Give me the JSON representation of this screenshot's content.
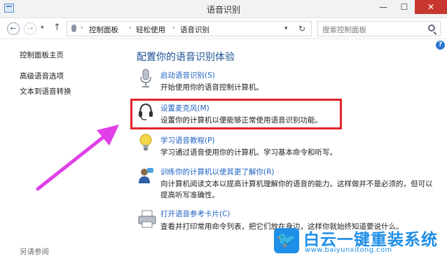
{
  "window": {
    "title": "语音识别",
    "minimize_glyph": "—",
    "maximize_glyph": "☐",
    "close_glyph": "✕"
  },
  "nav": {
    "back_glyph": "←",
    "forward_glyph": "→",
    "dropdown_glyph": "▾",
    "up_glyph": "↑",
    "breadcrumb": [
      "控制面板",
      "轻松使用",
      "语音识别"
    ],
    "crumb_separator": "›",
    "refresh_glyph": "↻",
    "search_placeholder": "搜索控制面板"
  },
  "sidebar": {
    "items": [
      "控制面板主页",
      "高级语音选项",
      "文本到语音转换"
    ],
    "see_also": "另请参阅"
  },
  "main": {
    "title": "配置你的语音识别体验",
    "tasks": [
      {
        "icon": "microphone-icon",
        "link": "启动语音识别(S)",
        "desc": [
          "开始使用你的语音控制计算机。"
        ]
      },
      {
        "icon": "headset-icon",
        "link": "设置麦克风(M)",
        "desc": [
          "设置你的计算机以便能够正常使用语音识别功能。"
        ]
      },
      {
        "icon": "lightbulb-icon",
        "link": "学习语音教程(P)",
        "desc": [
          "学习通过语音使用你的计算机。学习基本命令和听写。"
        ]
      },
      {
        "icon": "user-speech-icon",
        "link": "训练你的计算机以使其更了解你(R)",
        "desc": [
          "向计算机阅读文本以提高计算机理解你的语音的能力。这样做并不是必须的，但可以",
          "提高听写准确性。"
        ]
      },
      {
        "icon": "printer-icon",
        "link": "打开语音参考卡片(C)",
        "desc": [
          "查看并打印常用命令列表，把它们放在身边，这样你就始终知道要说什么。"
        ]
      }
    ]
  },
  "help_glyph": "?",
  "watermark": {
    "brand": "白云一键重装系统",
    "url": "www.baiyunxitong.com",
    "bird_glyph": "🐦"
  },
  "colors": {
    "link": "#1f63c4",
    "title": "#1a4f92",
    "highlight": "#e3232c",
    "arrow": "#e040e8",
    "watermark": "#1f8ee6"
  }
}
